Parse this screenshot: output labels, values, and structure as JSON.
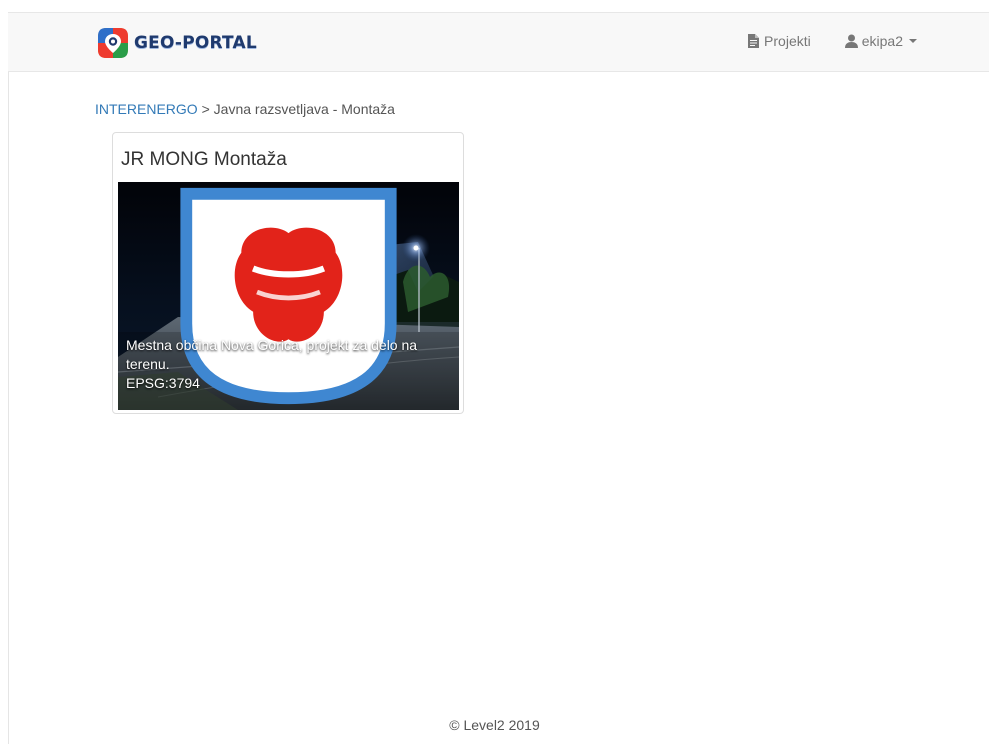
{
  "navbar": {
    "brand": "GEO-PORTAL",
    "projects_label": "Projekti",
    "user_label": "ekipa2"
  },
  "breadcrumb": {
    "root": "INTERENERGO",
    "separator": ">",
    "current": "Javna razsvetljava - Montaža"
  },
  "project": {
    "title": "JR MONG Montaža",
    "description": "Mestna občina Nova Gorica, projekt za delo na terenu.",
    "epsg": "EPSG:3794"
  },
  "footer": {
    "text": "© Level2 2019"
  },
  "colors": {
    "link": "#337ab7",
    "navbar_bg": "#f8f8f8",
    "brand_text": "#1f3a6e",
    "emblem_red": "#e2231a"
  },
  "icons": {
    "brand": "geo-portal-logo",
    "projects": "file-icon",
    "user": "user-icon",
    "dropdown": "caret-down-icon",
    "emblem": "nova-gorica-emblem"
  }
}
